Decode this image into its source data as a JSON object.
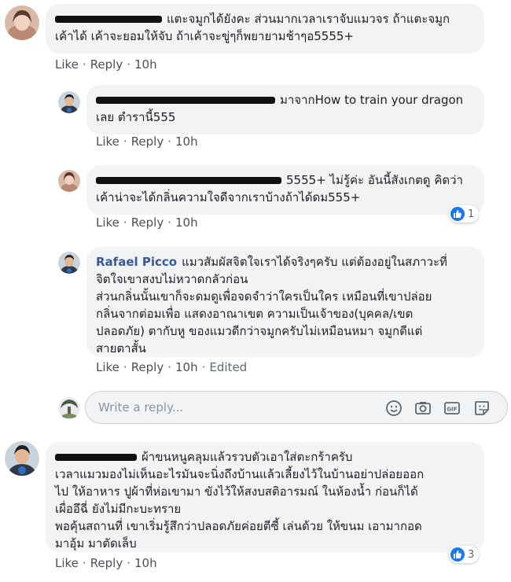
{
  "comments": [
    {
      "name": "",
      "text_line1": "แตะจมูกได้ยังคะ ส่วนมากเวลาเราจับแมวจร ถ้าแตะจมูก",
      "text_line2": "เค้าได้ เค้าจะยอมให้จับ ถ้าเค้าจะขู่ๆก็พยายามช้าๆอ5555+",
      "like": "Like",
      "reply": "Reply",
      "time": "10h"
    },
    {
      "name": "",
      "text_line1": "มาจากHow to train your dragon",
      "text_line2": "เลย ตำรานี้555",
      "like": "Like",
      "reply": "Reply",
      "time": "10h"
    },
    {
      "name": "",
      "text_line1": "5555+ ไม่รู้ค่ะ อันนี้สังเกตดู คิดว่า",
      "text_line2": "เค้าน่าจะได้กลิ่นความใจดีจากเราบ้างถ้าได้ดม555+",
      "like": "Like",
      "reply": "Reply",
      "time": "10h",
      "reaction_count": "1"
    },
    {
      "name": "Rafael Picco",
      "text_line1": "แมวสัมผัสจิตใจเราได้จริงๆครับ แต่ต้องอยู่ในสภาวะที่",
      "text_line2": "จิตใจเขาสงบไม่หวาดกลัวก่อน",
      "text_line3": "ส่วนกลิ่นนั้นเขาก็จะดมดูเพื่อจดจำว่าใครเป็นใคร เหมือนที่เขาปล่อย",
      "text_line4": "กลิ่นจากต่อมเพื่อ แสดงอาณาเขต ความเป็นเจ้าของ(บุคคล/เขต",
      "text_line5": "ปลอดภัย) ตากับหู ของแมวดีกว่าจมูกครับไม่เหมือนหมา จมูกดีแต่",
      "text_line6": "สายตาสั้น",
      "like": "Like",
      "reply": "Reply",
      "time": "10h",
      "edited": "Edited"
    },
    {
      "name": "",
      "text_line1": "ผ้าขนหนูคลุมแล้วรวบตัวเอาใส่ตะกร้าครับ",
      "text_line2": "เวลาแมวมองไม่เห็นอะไรมันจะนิ่งถึงบ้านแล้วเลี้ยงไว้ในบ้านอย่าปล่อยออก",
      "text_line3": "ไป ให้อาหาร ปูผ้าที่ห่อเขามา ขังไว้ให้สงบสติอารมณ์ ในห้องน้ำ ก่อนก็ได้",
      "text_line4": "เผื่ออึฉี่ ยังไม่มีกะบะทราย",
      "text_line5": "พอคุ้นสถานที่ เขาเริ่มรู้สึกว่าปลอดภัยค่อยตีซี้ เล่นด้วย ให้ขนม เอามากอด",
      "text_line6": "มาอุ้ม มาตัดเล็บ",
      "like": "Like",
      "reply": "Reply",
      "time": "10h",
      "reaction_count": "3"
    }
  ],
  "reply_box": {
    "placeholder": "Write a reply..."
  },
  "icons": {
    "emoji": "emoji-icon",
    "camera": "camera-icon",
    "gif": "gif-icon",
    "sticker": "sticker-icon",
    "like": "like-icon"
  },
  "colors": {
    "link_blue": "#385898",
    "like_blue": "#1877f2",
    "bubble": "#f2f3f5",
    "meta_gray": "#606770"
  }
}
